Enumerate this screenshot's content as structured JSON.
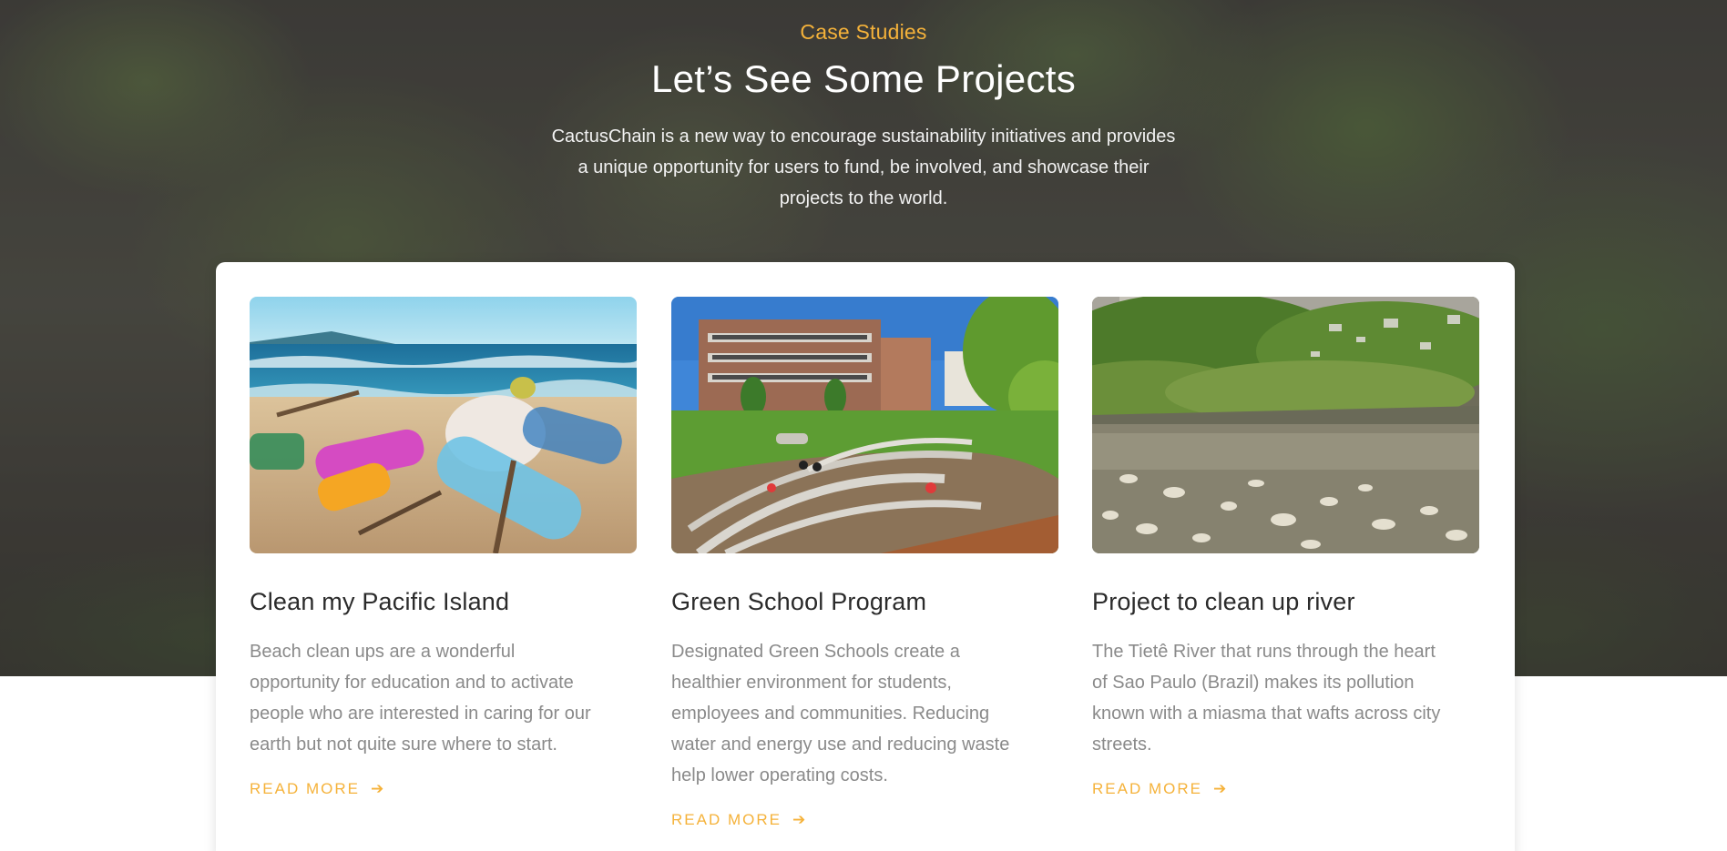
{
  "section": {
    "eyebrow": "Case Studies",
    "title": "Let’s See Some Projects",
    "intro": "CactusChain is a new way to encourage sustainability initiatives and provides a unique opportunity for users to fund, be involved, and showcase their projects to the world."
  },
  "cards": [
    {
      "title": "Clean my Pacific Island",
      "text": "Beach clean ups are a wonderful opportunity for education and to activate people who are interested in caring for our earth but not quite sure where to start.",
      "link": "READ MORE"
    },
    {
      "title": "Green School Program",
      "text": "Designated Green Schools create a healthier environment for students, employees and communities. Reducing water and energy use and reducing waste help lower operating costs.",
      "link": "READ MORE"
    },
    {
      "title": "Project to clean up river",
      "text": "The Tietê River that runs through the heart of Sao Paulo (Brazil) makes its pollution known with a miasma that wafts across city streets.",
      "link": "READ MORE"
    }
  ],
  "icons": {
    "arrow": "arrow-right-icon"
  },
  "colors": {
    "accent": "#f5b23a",
    "title": "#2b2b2b",
    "body_text": "#8a8a8a"
  }
}
